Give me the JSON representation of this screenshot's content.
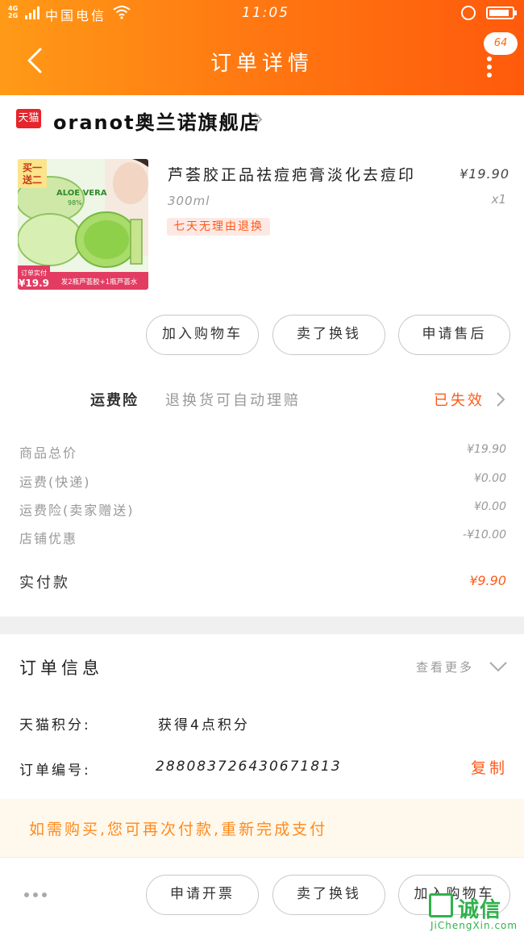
{
  "status_bar": {
    "network_top": "4G",
    "network_bottom": "2G",
    "carrier": "中国电信",
    "time": "11:05"
  },
  "header": {
    "title": "订单详情",
    "badge_count": "64"
  },
  "shop": {
    "platform_badge": "天猫",
    "name": "oranot奥兰诺旗舰店"
  },
  "product": {
    "title": "芦荟胶正品祛痘疤膏淡化去痘印",
    "price": "¥19.90",
    "spec": "300ml",
    "quantity": "x1",
    "tag": "七天无理由退换",
    "image": {
      "promo_top": "买一",
      "promo_bottom": "送二",
      "brand_text": "ALOE VERA",
      "percent": "98%",
      "paid_label": "订单实付",
      "paid_price": "¥19.9",
      "bottom_caption": "发2瓶芦荟胶+1瓶芦荟水"
    }
  },
  "actions": {
    "add_to_cart": "加入购物车",
    "sell_for_cash": "卖了换钱",
    "after_sales": "申请售后"
  },
  "insurance": {
    "label": "运费险",
    "description": "退换货可自动理赔",
    "status": "已失效"
  },
  "fees": [
    {
      "label": "商品总价",
      "value": "¥19.90"
    },
    {
      "label": "运费(快递)",
      "value": "¥0.00"
    },
    {
      "label": "运费险(卖家赠送)",
      "value": "¥0.00"
    },
    {
      "label": "店铺优惠",
      "value": "-¥10.00"
    }
  ],
  "total": {
    "label": "实付款",
    "value": "¥9.90"
  },
  "order_info": {
    "title": "订单信息",
    "more": "查看更多",
    "points_label": "天猫积分:",
    "points_value": "获得4点积分",
    "order_no_label": "订单编号:",
    "order_no_value": "288083726430671813",
    "copy": "复制"
  },
  "notice": "如需购买,您可再次付款,重新完成支付",
  "bottom_bar": {
    "invoice": "申请开票",
    "sell_for_cash": "卖了换钱",
    "add_to_cart": "加入购物车"
  },
  "watermark": {
    "name": "诚信",
    "url": "JiChengXin.com"
  },
  "colors": {
    "header_start": "#ff9a17",
    "header_end": "#ff5a0c",
    "accent": "#ff5a1a",
    "notice_bg": "#fff8ec",
    "tmall_red": "#e5242b"
  }
}
